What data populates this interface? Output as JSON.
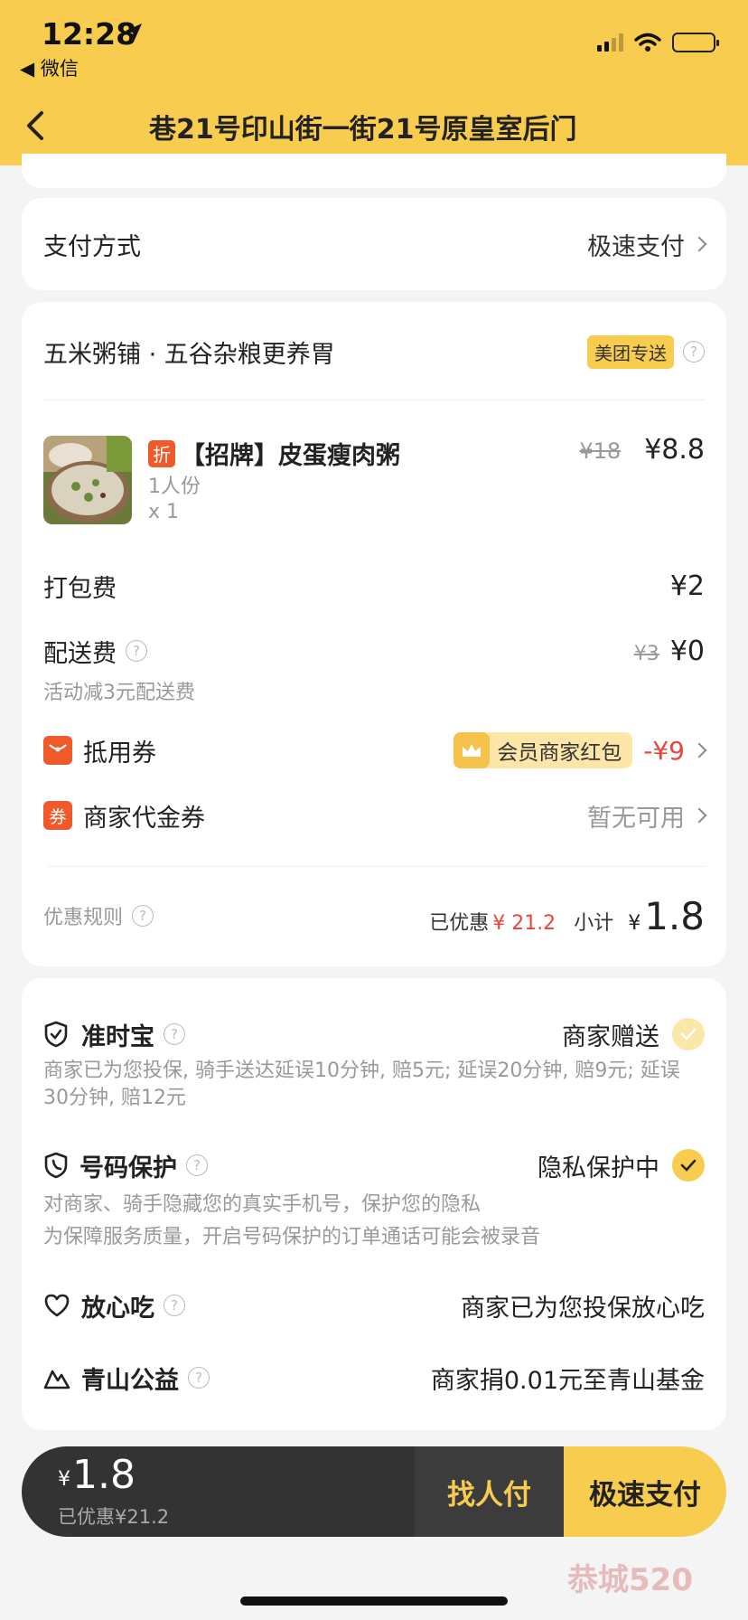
{
  "status_bar": {
    "time": "12:28",
    "back_app": "◀ 微信"
  },
  "nav": {
    "address": "巷21号印山街一街21号原皇室后门"
  },
  "payment": {
    "label": "支付方式",
    "value": "极速支付"
  },
  "order": {
    "shop_name": "五米粥铺 · 五谷杂粮更养胃",
    "delivery_tag": "美团专送",
    "item": {
      "discount_badge": "折",
      "name": "【招牌】皮蛋瘦肉粥",
      "spec": "1人份",
      "qty": "x 1",
      "original_price": "¥18",
      "price": "¥8.8"
    },
    "packing_fee": {
      "label": "打包费",
      "value": "¥2"
    },
    "delivery_fee": {
      "label": "配送费",
      "original": "¥3",
      "value": "¥0",
      "note": "活动减3元配送费"
    },
    "coupon": {
      "label": "抵用券",
      "vip_label": "会员商家红包",
      "amount": "-¥9"
    },
    "voucher": {
      "icon_text": "券",
      "label": "商家代金券",
      "value": "暂无可用"
    },
    "summary": {
      "rules_label": "优惠规则",
      "saved_label": "已优惠",
      "saved_value": "¥ 21.2",
      "subtotal_label": "小计",
      "subtotal_currency": "¥",
      "subtotal_value": "1.8"
    }
  },
  "services": {
    "ontime": {
      "title": "准时宝",
      "status": "商家赠送",
      "desc": "商家已为您投保, 骑手送达延误10分钟, 赔5元; 延误20分钟, 赔9元; 延误30分钟, 赔12元"
    },
    "privacy": {
      "title": "号码保护",
      "status": "隐私保护中",
      "desc1": "对商家、骑手隐藏您的真实手机号，保护您的隐私",
      "desc2": "为保障服务质量，开启号码保护的订单通话可能会被录音"
    },
    "safe_eat": {
      "title": "放心吃",
      "status": "商家已为您投保放心吃"
    },
    "charity": {
      "title": "青山公益",
      "status": "商家捐0.01元至青山基金"
    }
  },
  "bottom_bar": {
    "currency": "¥",
    "total": "1.8",
    "saved": "已优惠¥21.2",
    "find_pay": "找人付",
    "quick_pay": "极速支付"
  },
  "colors": {
    "brand_yellow": "#f8cc4f",
    "discount_red": "#f05a2a",
    "price_red": "#e8463a"
  }
}
